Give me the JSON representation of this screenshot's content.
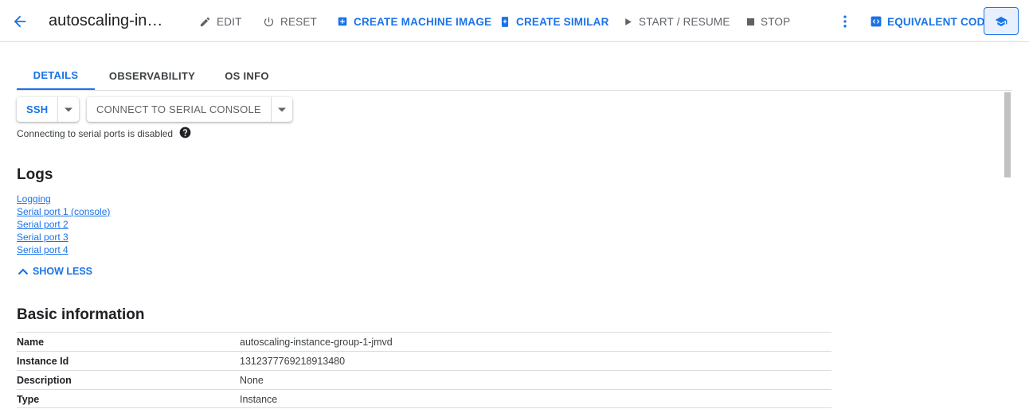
{
  "header": {
    "title": "autoscaling-in…",
    "buttons": {
      "edit": "EDIT",
      "reset": "RESET",
      "create_machine_image": "CREATE MACHINE IMAGE",
      "create_similar": "CREATE SIMILAR",
      "start_resume": "START / RESUME",
      "stop": "STOP",
      "equivalent_code": "EQUIVALENT CODE"
    },
    "icons": [
      "back-arrow-icon",
      "pencil-icon",
      "power-icon",
      "add-box-icon",
      "add-copy-icon",
      "play-icon",
      "stop-icon",
      "more-vert-icon",
      "code-icon",
      "school-icon"
    ]
  },
  "tabs": [
    {
      "label": "DETAILS",
      "active": true
    },
    {
      "label": "OBSERVABILITY",
      "active": false
    },
    {
      "label": "OS INFO",
      "active": false
    }
  ],
  "connect": {
    "ssh_label": "SSH",
    "serial_label": "CONNECT TO SERIAL CONSOLE",
    "serial_note": "Connecting to serial ports is disabled"
  },
  "logs": {
    "heading": "Logs",
    "links": [
      "Logging",
      "Serial port 1 (console)",
      "Serial port 2",
      "Serial port 3",
      "Serial port 4"
    ],
    "show_less": "SHOW LESS"
  },
  "basic_info": {
    "heading": "Basic information",
    "rows": [
      {
        "key": "Name",
        "value": "autoscaling-instance-group-1-jmvd"
      },
      {
        "key": "Instance Id",
        "value": "1312377769218913480"
      },
      {
        "key": "Description",
        "value": "None"
      },
      {
        "key": "Type",
        "value": "Instance"
      }
    ]
  },
  "colors": {
    "accent": "#1a73e8",
    "text": "#202124",
    "muted": "#5f6368",
    "divider": "#dadce0"
  }
}
